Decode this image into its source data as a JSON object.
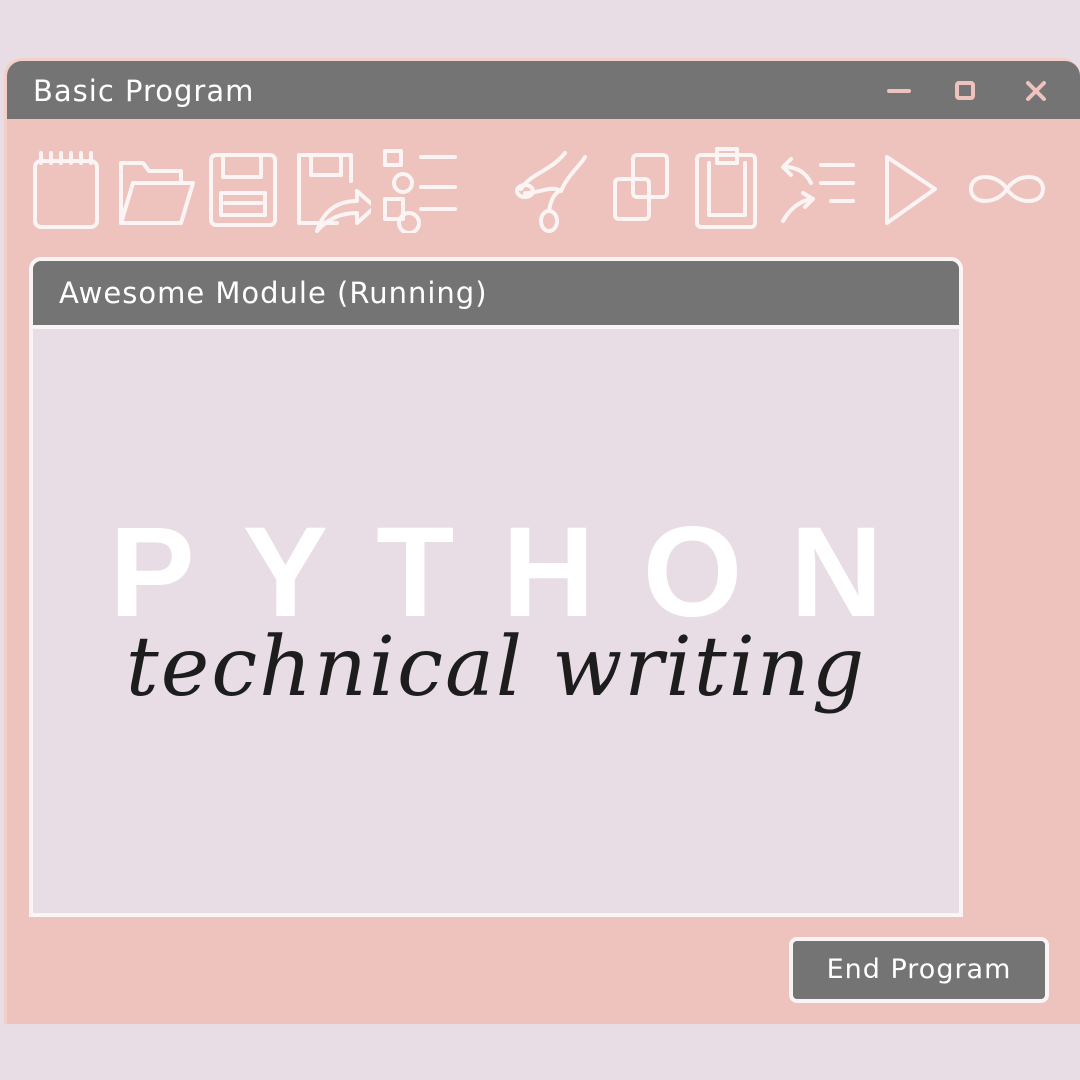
{
  "window": {
    "title": "Basic Program",
    "controls": [
      "minimize-icon",
      "maximize-icon",
      "close-icon"
    ]
  },
  "toolbar": {
    "icons": [
      "notepad-icon",
      "open-folder-icon",
      "save-icon",
      "save-as-icon",
      "shapes-list-icon",
      "cut-icon",
      "copy-icon",
      "paste-icon",
      "swap-list-icon",
      "play-icon",
      "loop-icon"
    ]
  },
  "module": {
    "title": "Awesome Module (Running)",
    "heading": "PYTHON",
    "subheading": "technical writing"
  },
  "footer": {
    "end_button_label": "End Program"
  },
  "colors": {
    "background": "#e8dde5",
    "window": "#eec3bd",
    "titlebar": "#747474",
    "icon_stroke": "#fbf4f4",
    "control_icon": "#eec3bd",
    "subheading_text": "#1d1d1d"
  }
}
